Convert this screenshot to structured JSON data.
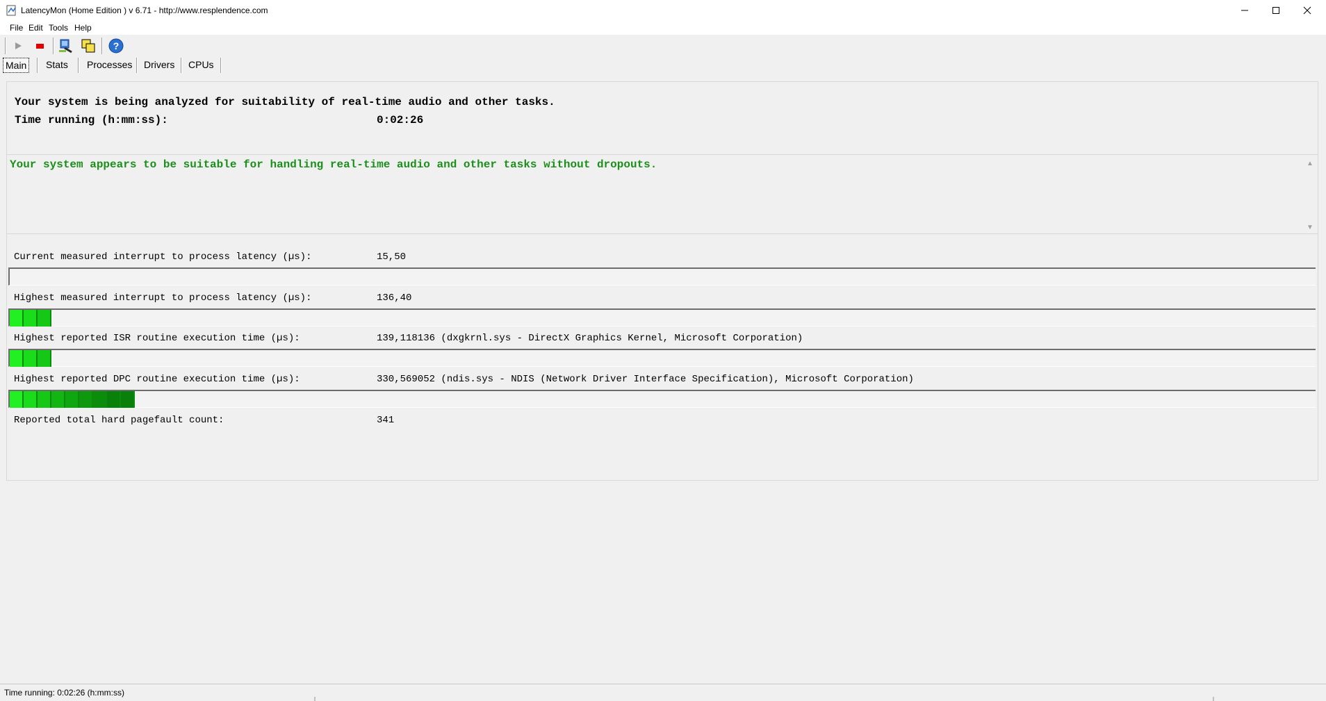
{
  "window": {
    "title": "LatencyMon  (Home Edition )  v 6.71 - http://www.resplendence.com"
  },
  "menu": [
    "File",
    "Edit",
    "Tools",
    "Help"
  ],
  "toolbar": [
    "play-icon",
    "stop-icon",
    "analyze-icon",
    "windows-icon",
    "help-icon"
  ],
  "tabs": [
    "Main",
    "Stats",
    "Processes",
    "Drivers",
    "CPUs"
  ],
  "header": {
    "analyzing": "Your system is being analyzed for suitability of real-time audio and other tasks.",
    "time_label": "Time running (h:mm:ss):",
    "time_value": "0:02:26"
  },
  "verdict": {
    "text": "Your system appears to be suitable for handling real-time audio and other tasks without dropouts.",
    "color": "#1a8f1a"
  },
  "metrics": [
    {
      "label": "Current measured interrupt to process latency (µs):",
      "value": "15,50",
      "bar_fraction": 0
    },
    {
      "label": "Highest measured interrupt to process latency (µs):",
      "value": "136,40",
      "bar_fraction": 0.0319
    },
    {
      "label": "Highest reported ISR routine execution time (µs):",
      "value": "139,118136  (dxgkrnl.sys - DirectX Graphics Kernel, Microsoft Corporation)",
      "bar_fraction": 0.0325
    },
    {
      "label": "Highest reported DPC routine execution time (µs):",
      "value": "330,569052  (ndis.sys - NDIS (Network Driver Interface Specification), Microsoft Corporation)",
      "bar_fraction": 0.0915
    },
    {
      "label": "Reported total hard pagefault count:",
      "value": "341"
    }
  ],
  "statusbar": {
    "text": "Time running: 0:02:26  (h:mm:ss)"
  }
}
